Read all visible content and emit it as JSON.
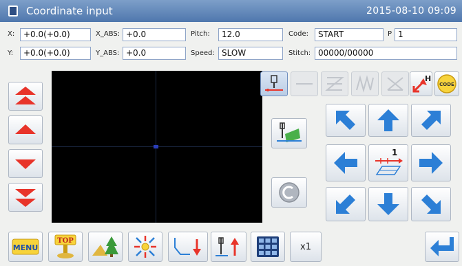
{
  "window": {
    "title": "Coordinate input",
    "datetime": "2015-08-10 09:09",
    "title_icon": "window-icon"
  },
  "fields": {
    "x": {
      "label": "X:",
      "value": "+0.0(+0.0)"
    },
    "x_abs": {
      "label": "X_ABS:",
      "value": "+0.0"
    },
    "pitch": {
      "label": "Pitch:",
      "value": "12.0"
    },
    "code": {
      "label": "Code:",
      "value": "START"
    },
    "p": {
      "label": "P",
      "value": "1"
    },
    "y": {
      "label": "Y:",
      "value": "+0.0(+0.0)"
    },
    "y_abs": {
      "label": "Y_ABS:",
      "value": "+0.0"
    },
    "speed": {
      "label": "Speed:",
      "value": "SLOW"
    },
    "stitch": {
      "label": "Stitch:",
      "value": "00000/00000"
    }
  },
  "speed_buttons": [
    "fastest-up-icon",
    "up-icon",
    "down-icon",
    "fastest-down-icon"
  ],
  "mode_toolbar": [
    "needle-point-icon",
    "line-icon",
    "zigzag-disabled-icon",
    "double-zigzag-disabled-icon",
    "cross-disabled-icon",
    "home-position-icon",
    "code-icon"
  ],
  "mode_toolbar_code_label": "CODE",
  "home_letter": "H",
  "side_buttons": [
    "needle-feed-icon",
    "copyright-icon"
  ],
  "direction_pad": [
    "up-left",
    "up",
    "up-right",
    "left",
    "center-step",
    "right",
    "down-left",
    "down",
    "down-right"
  ],
  "step_count": "1",
  "bottom_bar": {
    "menu_label": "MENU",
    "top_label": "TOP",
    "multiplier": "x1",
    "icons": [
      "menu-icon",
      "top-icon",
      "scenery-icon",
      "zoom-fit-icon",
      "needle-down-icon",
      "needle-up-icon",
      "numeric-keypad-icon",
      "enter-icon"
    ]
  },
  "colors": {
    "titlebar": "#5a7fb5",
    "arrow_blue": "#2c7fd6",
    "arrow_red": "#e8342a",
    "field_border": "#8fa5c8",
    "viewport": "#000000"
  }
}
